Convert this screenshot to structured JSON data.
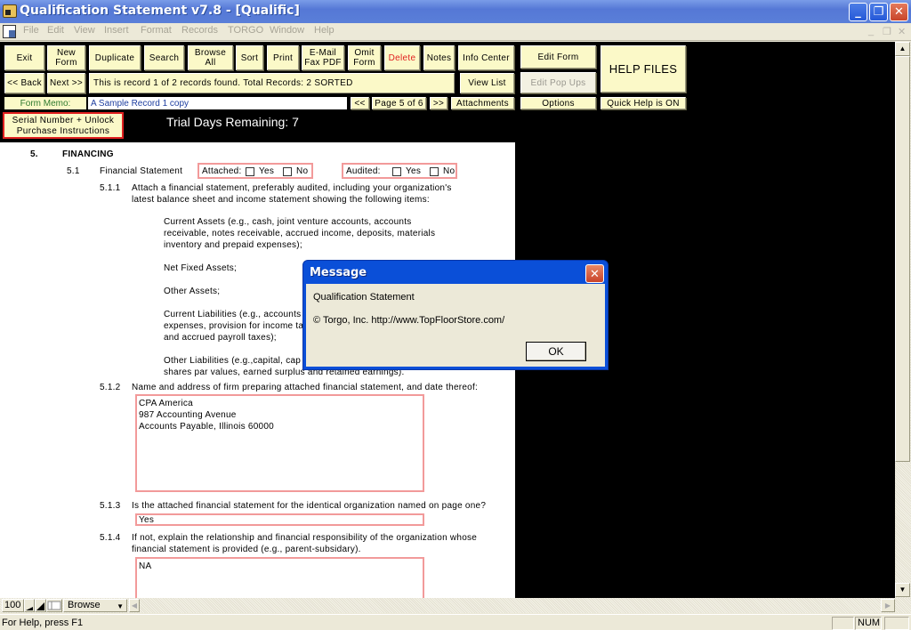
{
  "window": {
    "title": "Qualification Statement v7.8 - [Qualific]",
    "controls": {
      "minimize": "_",
      "restore": "❐",
      "close": "✕"
    }
  },
  "menu": {
    "items": [
      "File",
      "Edit",
      "View",
      "Insert",
      "Format",
      "Records",
      "TORGO",
      "Window",
      "Help"
    ],
    "mdi_controls": {
      "minimize": "_",
      "restore": "❐",
      "close": "✕"
    }
  },
  "toolbar": {
    "exit": "Exit",
    "new_form": "New Form",
    "duplicate": "Duplicate",
    "search": "Search",
    "browse_all": "Browse All",
    "sort": "Sort",
    "print": "Print",
    "email_fax_pdf": "E-Mail Fax PDF",
    "omit_form": "Omit Form",
    "delete": "Delete",
    "notes": "Notes",
    "info_center": "Info Center",
    "edit_form": "Edit Form",
    "help_files": "HELP FILES",
    "back": "<< Back",
    "next": "Next >>",
    "record_status": "This is record 1 of 2 records found.   Total Records: 2   SORTED",
    "view_list": "View List",
    "edit_pop_ups": "Edit Pop Ups",
    "form_memo_label": "Form Memo:",
    "form_memo_value": "A Sample Record 1 copy",
    "prev_page": "<<",
    "page_indicator": "Page 5 of 6",
    "next_page": ">>",
    "attachments": "Attachments",
    "options": "Options",
    "quick_help": "Quick Help is ON",
    "serial_line1": "Serial Number + Unlock",
    "serial_line2": "Purchase Instructions",
    "trial_text": "Trial Days Remaining: 7"
  },
  "document": {
    "section_number": "5.",
    "section_title": "FINANCING",
    "s51_number": "5.1",
    "s51_label": "Financial Statement",
    "attached_label": "Attached:",
    "audited_label": "Audited:",
    "yes": "Yes",
    "no": "No",
    "attached_yes_checked": false,
    "attached_no_checked": false,
    "audited_yes_checked": false,
    "audited_no_checked": false,
    "s511_number": "5.1.1",
    "s511_line1": "Attach a financial statement, preferably audited, including your organization's",
    "s511_line2": "latest balance sheet and income statement showing the following items:",
    "current_assets_1": "Current Assets (e.g., cash, joint venture accounts, accounts",
    "current_assets_2": "receivable, notes receivable, accrued income, deposits, materials",
    "current_assets_3": "inventory and prepaid expenses);",
    "net_fixed_assets": "Net Fixed Assets;",
    "other_assets": "Other Assets;",
    "current_liabilities_1": "Current Liabilities (e.g., accounts",
    "current_liabilities_2": "expenses, provision for income ta",
    "current_liabilities_3": "and accrued payroll taxes);",
    "other_liabilities_1": "Other Liabilities (e.g.,capital, cap",
    "other_liabilities_2": "shares par values, earned surplus and retained earnings).",
    "s512_number": "5.1.2",
    "s512_text": "Name and address of firm preparing attached financial statement, and date thereof:",
    "s512_value": "CPA America\n987 Accounting Avenue\nAccounts Payable, Illinois  60000",
    "s513_number": "5.1.3",
    "s513_text": "Is the attached financial statement for the identical organization named on page one?",
    "s513_value": "Yes",
    "s514_number": "5.1.4",
    "s514_line1": "If not, explain the relationship and financial responsibility of the organization whose",
    "s514_line2": "financial statement is provided (e.g., parent-subsidary).",
    "s514_value": "NA"
  },
  "scrollbar": {
    "up": "▲",
    "down": "▼",
    "left": "◀",
    "right": "▶"
  },
  "bottom_bar": {
    "zoom": "100",
    "mode": "Browse",
    "mode_arrow": "▼"
  },
  "statusbar": {
    "help_text": "For Help, press F1",
    "num": "NUM"
  },
  "dialog": {
    "title": "Message",
    "line1": "Qualification Statement",
    "line2": "© Torgo, Inc. http://www.TopFloorStore.com/",
    "ok": "OK",
    "close": "✕"
  }
}
